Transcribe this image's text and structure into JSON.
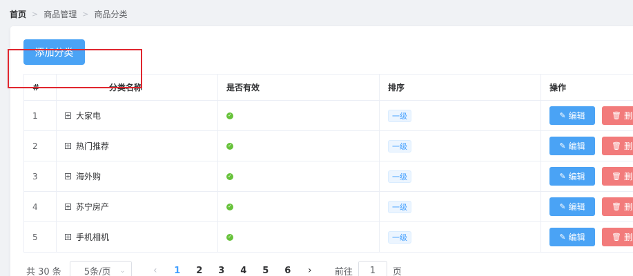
{
  "breadcrumb": [
    "首页",
    "商品管理",
    "商品分类"
  ],
  "add_button": "添加分类",
  "table": {
    "headers": [
      "#",
      "分类名称",
      "是否有效",
      "排序",
      "操作"
    ],
    "rows": [
      {
        "index": "1",
        "name": "大家电",
        "level": "一级"
      },
      {
        "index": "2",
        "name": "热门推荐",
        "level": "一级"
      },
      {
        "index": "3",
        "name": "海外购",
        "level": "一级"
      },
      {
        "index": "4",
        "name": "苏宁房产",
        "level": "一级"
      },
      {
        "index": "5",
        "name": "手机相机",
        "level": "一级"
      }
    ],
    "edit_label": "编辑",
    "delete_label": "删除"
  },
  "pagination": {
    "total": "共 30 条",
    "page_size": "5条/页",
    "pages": [
      "1",
      "2",
      "3",
      "4",
      "5",
      "6"
    ],
    "current_page": "1",
    "goto_prefix": "前往",
    "goto_value": "1",
    "goto_suffix": "页"
  },
  "colors": {
    "primary": "#4aa3f5",
    "danger": "#f27b7b",
    "success": "#67c23a",
    "highlight": "#e0262e"
  }
}
